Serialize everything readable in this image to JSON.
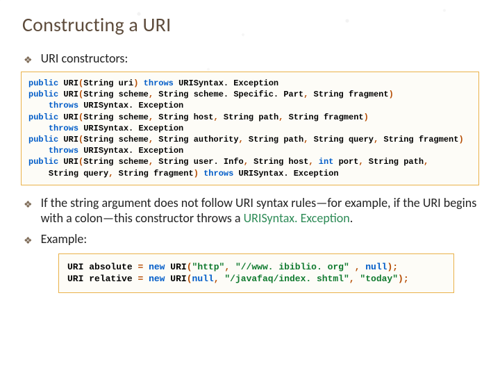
{
  "title": "Constructing a URI",
  "bullets": {
    "constructors": "URI constructors:",
    "explain_pre": "If the string argument does not follow URI syntax rules—for example, if the URI begins with a colon—this constructor throws a ",
    "explain_green": "URISyntax. Exception",
    "explain_post": ".",
    "example": "Example:"
  },
  "code1": {
    "lines": [
      [
        [
          "kw",
          "public"
        ],
        [
          "sp",
          " "
        ],
        [
          "typ",
          "URI"
        ],
        [
          "pun",
          "("
        ],
        [
          "typ",
          "String"
        ],
        [
          "sp",
          " "
        ],
        [
          "id",
          "uri"
        ],
        [
          "pun",
          ")"
        ],
        [
          "sp",
          " "
        ],
        [
          "kw",
          "throws"
        ],
        [
          "sp",
          " "
        ],
        [
          "exc",
          "URISyntax. Exception"
        ]
      ],
      [
        [
          "kw",
          "public"
        ],
        [
          "sp",
          " "
        ],
        [
          "typ",
          "URI"
        ],
        [
          "pun",
          "("
        ],
        [
          "typ",
          "String"
        ],
        [
          "sp",
          " "
        ],
        [
          "id",
          "scheme"
        ],
        [
          "pun",
          ","
        ],
        [
          "sp",
          " "
        ],
        [
          "typ",
          "String"
        ],
        [
          "sp",
          " "
        ],
        [
          "id",
          "scheme. Specific. Part"
        ],
        [
          "pun",
          ","
        ],
        [
          "sp",
          " "
        ],
        [
          "typ",
          "String"
        ],
        [
          "sp",
          " "
        ],
        [
          "id",
          "fragment"
        ],
        [
          "pun",
          ")"
        ]
      ],
      [
        [
          "sp",
          "    "
        ],
        [
          "kw",
          "throws"
        ],
        [
          "sp",
          " "
        ],
        [
          "exc",
          "URISyntax. Exception"
        ]
      ],
      [
        [
          "kw",
          "public"
        ],
        [
          "sp",
          " "
        ],
        [
          "typ",
          "URI"
        ],
        [
          "pun",
          "("
        ],
        [
          "typ",
          "String"
        ],
        [
          "sp",
          " "
        ],
        [
          "id",
          "scheme"
        ],
        [
          "pun",
          ","
        ],
        [
          "sp",
          " "
        ],
        [
          "typ",
          "String"
        ],
        [
          "sp",
          " "
        ],
        [
          "id",
          "host"
        ],
        [
          "pun",
          ","
        ],
        [
          "sp",
          " "
        ],
        [
          "typ",
          "String"
        ],
        [
          "sp",
          " "
        ],
        [
          "id",
          "path"
        ],
        [
          "pun",
          ","
        ],
        [
          "sp",
          " "
        ],
        [
          "typ",
          "String"
        ],
        [
          "sp",
          " "
        ],
        [
          "id",
          "fragment"
        ],
        [
          "pun",
          ")"
        ]
      ],
      [
        [
          "sp",
          "    "
        ],
        [
          "kw",
          "throws"
        ],
        [
          "sp",
          " "
        ],
        [
          "exc",
          "URISyntax. Exception"
        ]
      ],
      [
        [
          "kw",
          "public"
        ],
        [
          "sp",
          " "
        ],
        [
          "typ",
          "URI"
        ],
        [
          "pun",
          "("
        ],
        [
          "typ",
          "String"
        ],
        [
          "sp",
          " "
        ],
        [
          "id",
          "scheme"
        ],
        [
          "pun",
          ","
        ],
        [
          "sp",
          " "
        ],
        [
          "typ",
          "String"
        ],
        [
          "sp",
          " "
        ],
        [
          "id",
          "authority"
        ],
        [
          "pun",
          ","
        ],
        [
          "sp",
          " "
        ],
        [
          "typ",
          "String"
        ],
        [
          "sp",
          " "
        ],
        [
          "id",
          "path"
        ],
        [
          "pun",
          ","
        ],
        [
          "sp",
          " "
        ],
        [
          "typ",
          "String"
        ],
        [
          "sp",
          " "
        ],
        [
          "id",
          "query"
        ],
        [
          "pun",
          ","
        ],
        [
          "sp",
          " "
        ],
        [
          "typ",
          "String"
        ],
        [
          "sp",
          " "
        ],
        [
          "id",
          "fragment"
        ],
        [
          "pun",
          ")"
        ]
      ],
      [
        [
          "sp",
          "    "
        ],
        [
          "kw",
          "throws"
        ],
        [
          "sp",
          " "
        ],
        [
          "exc",
          "URISyntax. Exception"
        ]
      ],
      [
        [
          "kw",
          "public"
        ],
        [
          "sp",
          " "
        ],
        [
          "typ",
          "URI"
        ],
        [
          "pun",
          "("
        ],
        [
          "typ",
          "String"
        ],
        [
          "sp",
          " "
        ],
        [
          "id",
          "scheme"
        ],
        [
          "pun",
          ","
        ],
        [
          "sp",
          " "
        ],
        [
          "typ",
          "String"
        ],
        [
          "sp",
          " "
        ],
        [
          "id",
          "user. Info"
        ],
        [
          "pun",
          ","
        ],
        [
          "sp",
          " "
        ],
        [
          "typ",
          "String"
        ],
        [
          "sp",
          " "
        ],
        [
          "id",
          "host"
        ],
        [
          "pun",
          ","
        ],
        [
          "sp",
          " "
        ],
        [
          "kw",
          "int"
        ],
        [
          "sp",
          " "
        ],
        [
          "id",
          "port"
        ],
        [
          "pun",
          ","
        ],
        [
          "sp",
          " "
        ],
        [
          "typ",
          "String"
        ],
        [
          "sp",
          " "
        ],
        [
          "id",
          "path"
        ],
        [
          "pun",
          ","
        ]
      ],
      [
        [
          "sp",
          "    "
        ],
        [
          "typ",
          "String"
        ],
        [
          "sp",
          " "
        ],
        [
          "id",
          "query"
        ],
        [
          "pun",
          ","
        ],
        [
          "sp",
          " "
        ],
        [
          "typ",
          "String"
        ],
        [
          "sp",
          " "
        ],
        [
          "id",
          "fragment"
        ],
        [
          "pun",
          ")"
        ],
        [
          "sp",
          " "
        ],
        [
          "kw",
          "throws"
        ],
        [
          "sp",
          " "
        ],
        [
          "exc",
          "URISyntax. Exception"
        ]
      ]
    ]
  },
  "code2": {
    "lines": [
      [
        [
          "typ",
          "URI"
        ],
        [
          "sp",
          " "
        ],
        [
          "id",
          "absolute"
        ],
        [
          "sp",
          " "
        ],
        [
          "pun",
          "="
        ],
        [
          "sp",
          " "
        ],
        [
          "kw",
          "new"
        ],
        [
          "sp",
          " "
        ],
        [
          "typ",
          "URI"
        ],
        [
          "pun",
          "("
        ],
        [
          "str",
          "\"http\""
        ],
        [
          "pun",
          ","
        ],
        [
          "sp",
          " "
        ],
        [
          "str",
          "\"//www. ibiblio. org\""
        ],
        [
          "sp",
          " "
        ],
        [
          "pun",
          ","
        ],
        [
          "sp",
          " "
        ],
        [
          "kw",
          "null"
        ],
        [
          "pun",
          ");"
        ]
      ],
      [
        [
          "typ",
          "URI"
        ],
        [
          "sp",
          " "
        ],
        [
          "id",
          "relative"
        ],
        [
          "sp",
          " "
        ],
        [
          "pun",
          "="
        ],
        [
          "sp",
          " "
        ],
        [
          "kw",
          "new"
        ],
        [
          "sp",
          " "
        ],
        [
          "typ",
          "URI"
        ],
        [
          "pun",
          "("
        ],
        [
          "kw",
          "null"
        ],
        [
          "pun",
          ","
        ],
        [
          "sp",
          " "
        ],
        [
          "str",
          "\"/javafaq/index. shtml\""
        ],
        [
          "pun",
          ","
        ],
        [
          "sp",
          " "
        ],
        [
          "str",
          "\"today\""
        ],
        [
          "pun",
          ");"
        ]
      ]
    ]
  }
}
